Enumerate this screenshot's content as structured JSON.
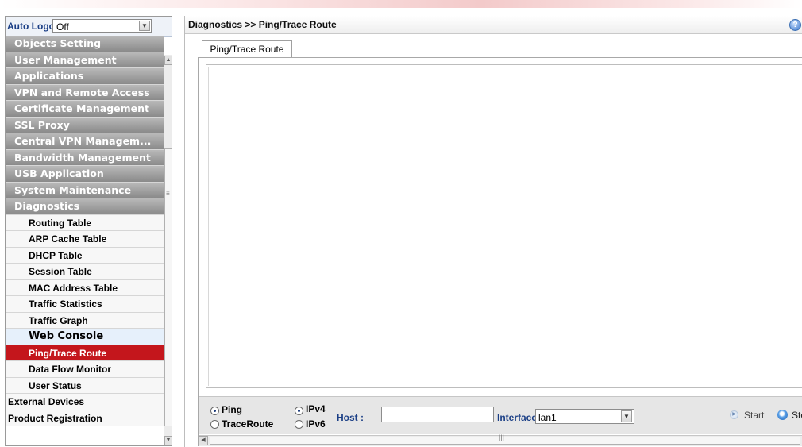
{
  "breadcrumb": "Diagnostics >> Ping/Trace Route",
  "help_icon": "?",
  "auto_logout": {
    "label": "Auto Logout",
    "sep": " : ",
    "value": "Off"
  },
  "menu": {
    "headers": [
      "Objects Setting",
      "User Management",
      "Applications",
      "VPN and Remote Access",
      "Certificate Management",
      "SSL Proxy",
      "Central VPN Managem...",
      "Bandwidth Management",
      "USB Application",
      "System Maintenance",
      "Diagnostics"
    ],
    "items": [
      "Routing Table",
      "ARP Cache Table",
      "DHCP Table",
      "Session Table",
      "MAC Address Table",
      "Traffic Statistics",
      "Traffic Graph",
      "Web Console",
      "Ping/Trace Route",
      "Data Flow Monitor",
      "User Status"
    ],
    "top_items": [
      "External Devices",
      "Product Registration"
    ]
  },
  "tab": {
    "label": "Ping/Trace Route"
  },
  "controls": {
    "mode_options": [
      "Ping",
      "TraceRoute"
    ],
    "mode_selected": "Ping",
    "ip_options": [
      "IPv4",
      "IPv6"
    ],
    "ip_selected": "IPv4",
    "host_label": "Host :",
    "host_value": "",
    "interface_label": "Interface",
    "interface_sep": " : ",
    "interface_value": "lan1",
    "start_label": "Start",
    "stop_label": "Stop"
  },
  "colors": {
    "active_item": "#c4161c",
    "header_bg": "#a0a0a0",
    "label_blue": "#1b3f86"
  }
}
